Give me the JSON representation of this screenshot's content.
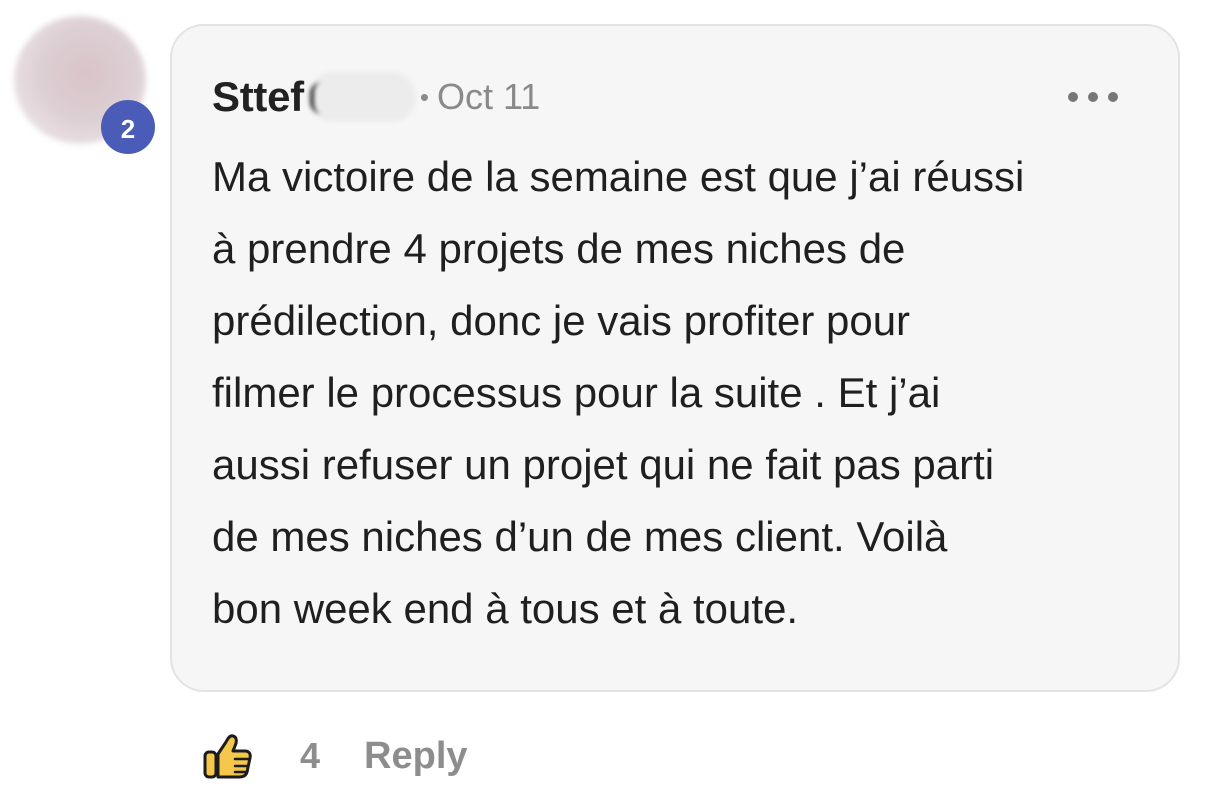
{
  "comment": {
    "author": "Sttef",
    "level": "2",
    "separator": "•",
    "date": "Oct 11",
    "body": "Ma victoire de la semaine est que j’ai réussi\nà prendre 4 projets de mes niches de\nprédilection, donc je vais profiter pour\nfilmer le processus pour la suite . Et j’ai\naussi refuser un projet qui ne fait pas parti\nde mes niches d’un de mes client. Voilà\nbon week end à tous et à toute.",
    "like_count": "4",
    "reply_label": "Reply"
  },
  "icons": {
    "like": "thumbs-up-icon",
    "more": "more-horizontal-icon"
  },
  "colors": {
    "level_badge": "#4a5bb8",
    "bubble_bg": "#f7f6f6",
    "like_fill": "#f5c74a",
    "muted_text": "#8d8d8d"
  }
}
